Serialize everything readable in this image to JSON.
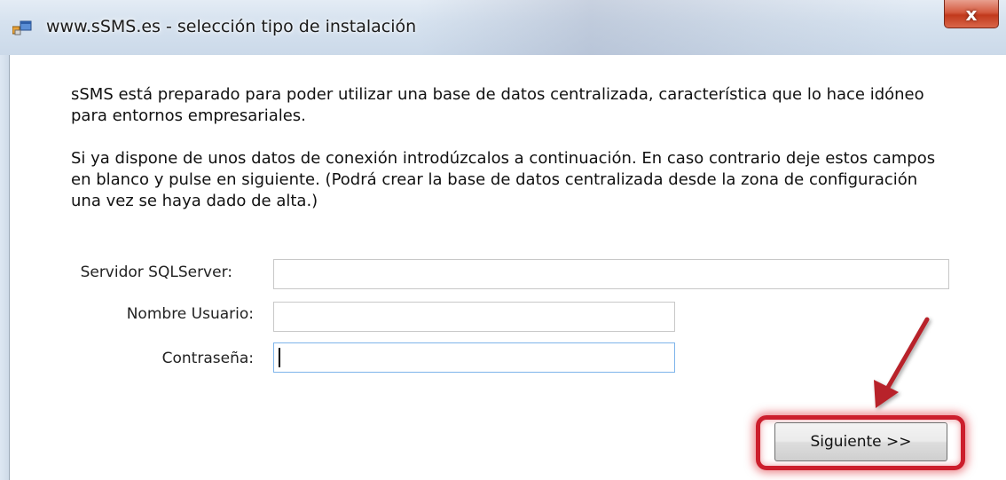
{
  "window": {
    "title": "www.sSMS.es - selección tipo de instalación",
    "close_label": "x"
  },
  "intro": {
    "paragraph1": "sSMS está preparado para poder utilizar una base de datos centralizada, característica que lo hace idóneo para entornos empresariales.",
    "paragraph2": "Si ya dispone de unos datos de conexión introdúzcalos a continuación. En caso contrario deje estos campos en blanco y pulse en siguiente. (Podrá crear la base de datos centralizada desde la zona de configuración una vez se haya dado de alta.)"
  },
  "form": {
    "server_label": "Servidor SQLServer:",
    "server_value": "",
    "user_label": "Nombre Usuario:",
    "user_value": "",
    "password_label": "Contraseña:",
    "password_value": ""
  },
  "buttons": {
    "next_label": "Siguiente >>"
  },
  "annotation": {
    "highlight_color": "#cc1e2c",
    "arrow_color": "#b8232a"
  },
  "icons": {
    "app": "app-window-icon",
    "close": "close-icon",
    "arrow": "pointer-arrow-icon"
  }
}
